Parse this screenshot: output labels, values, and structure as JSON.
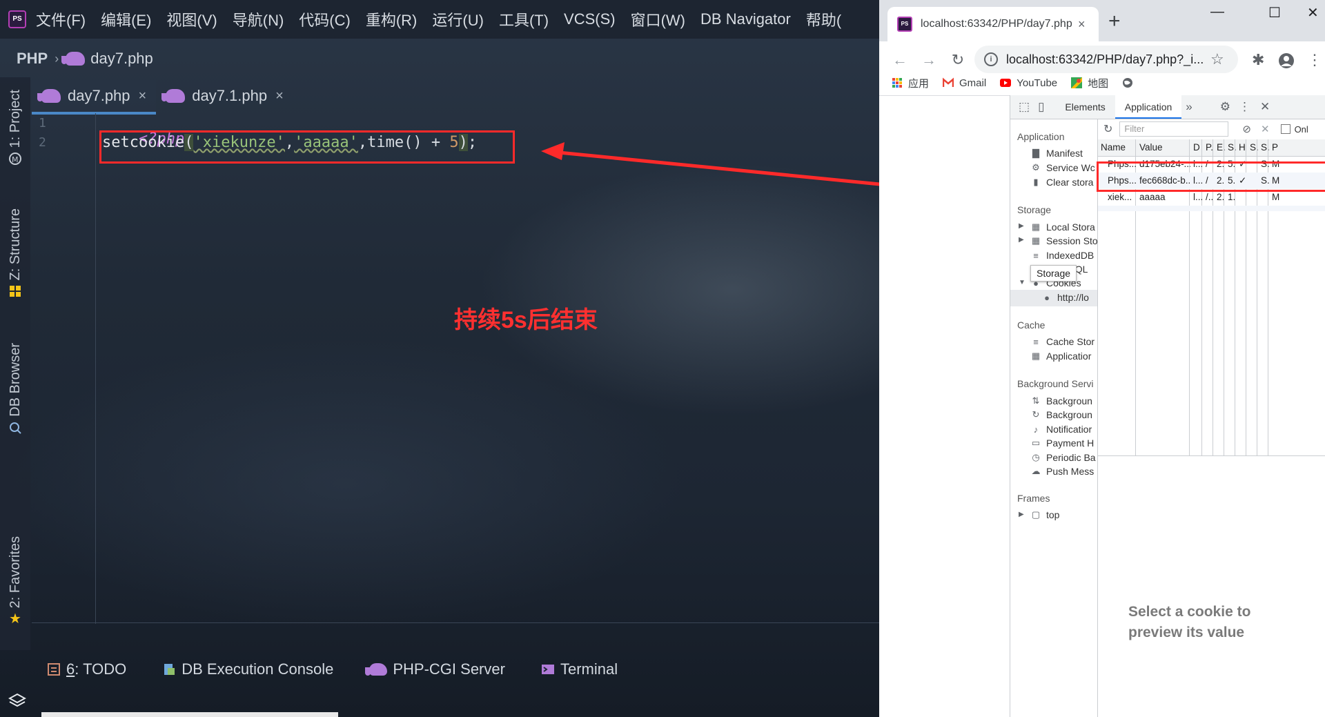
{
  "ide": {
    "menu": [
      "文件(F)",
      "编辑(E)",
      "视图(V)",
      "导航(N)",
      "代码(C)",
      "重构(R)",
      "运行(U)",
      "工具(T)",
      "VCS(S)",
      "窗口(W)",
      "DB Navigator",
      "帮助("
    ],
    "app_logo": "PS",
    "breadcrumb": {
      "root": "PHP",
      "separator": "›",
      "file": "day7.php"
    },
    "left_tabs": {
      "project": "1: Project",
      "structure": "Z: Structure",
      "db_browser": "DB Browser",
      "favorites": "2: Favorites"
    },
    "tabs": [
      {
        "label": "day7.php",
        "active": true
      },
      {
        "label": "day7.1.php",
        "active": false
      }
    ],
    "tab_close": "×",
    "line_numbers": [
      "1",
      "2"
    ],
    "code": {
      "line1": "<?php",
      "line2": {
        "func": "setcookie",
        "open_paren": "(",
        "arg1": "'xiekunze'",
        "comma1": ",",
        "arg2": "'aaaaa'",
        "comma2": ",",
        "arg3": "time() + ",
        "num": "5",
        "close_paren": ")",
        "end": ";"
      }
    },
    "annotation": "持续5s后结束",
    "bottom_tools": {
      "todo_num": "6",
      "todo_label": ": TODO",
      "db_console": "DB Execution Console",
      "php_server": "PHP-CGI Server",
      "terminal": "Terminal"
    }
  },
  "browser": {
    "tab_title": "localhost:63342/PHP/day7.php",
    "tab_close": "×",
    "new_tab": "+",
    "window_controls": {
      "minimize": "—",
      "maximize": "☐",
      "close": "✕"
    },
    "nav": {
      "back": "←",
      "forward": "→",
      "reload": "↻"
    },
    "url": "localhost:63342/PHP/day7.php?_i...",
    "bookmarks": [
      "应用",
      "Gmail",
      "YouTube",
      "地图"
    ],
    "devtools": {
      "tabs": [
        "Elements",
        "Application"
      ],
      "active_tab": "Application",
      "more": "»",
      "close": "✕",
      "sidebar": {
        "application_header": "Application",
        "application_items": [
          "Manifest",
          "Service Wc",
          "Clear stora"
        ],
        "storage_header": "Storage",
        "storage_items": [
          "Local Stora",
          "Session Sto",
          "IndexedDB",
          "Web SQL",
          "Cookies",
          "http://lo"
        ],
        "storage_tooltip": "Storage",
        "cache_header": "Cache",
        "cache_items": [
          "Cache Stor",
          "Applicatior"
        ],
        "background_header": "Background Servi",
        "background_items": [
          "Backgroun",
          "Backgroun",
          "Notificatior",
          "Payment H",
          "Periodic Ba",
          "Push Mess"
        ],
        "frames_header": "Frames",
        "frames_items": [
          "top"
        ]
      },
      "filter_placeholder": "Filter",
      "only_label": "Onl",
      "columns": [
        "Name",
        "Value",
        "D",
        "P.",
        "E.",
        "S.",
        "H",
        "S.",
        "S.",
        "P"
      ],
      "rows": [
        [
          "Phps...",
          "d175eb24-...",
          "l...",
          "/",
          "2..",
          "5..",
          "✓",
          "",
          "S..",
          "M"
        ],
        [
          "Phps...",
          "fec668dc-b...",
          "l...",
          "/",
          "2..",
          "5..",
          "✓",
          "",
          "S..",
          "M"
        ],
        [
          "xiek...",
          "aaaaa",
          "l...",
          "/...",
          "2..",
          "1..",
          "",
          "",
          "",
          "M"
        ]
      ],
      "preview_message": "Select a cookie to preview its value"
    }
  }
}
